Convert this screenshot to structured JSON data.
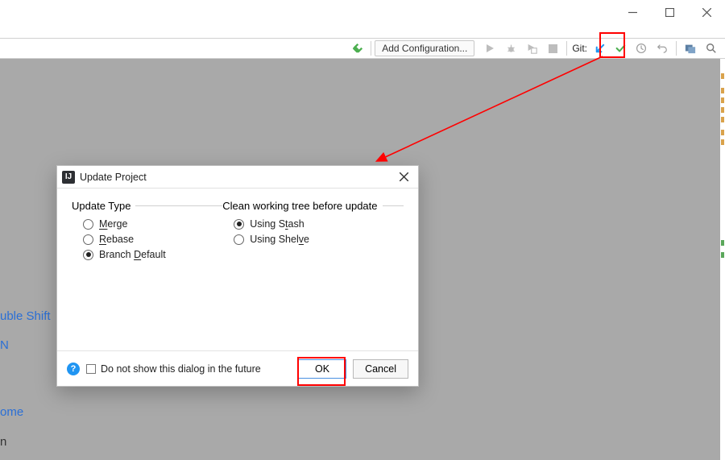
{
  "window_controls": {
    "min": "minimize-icon",
    "max": "maximize-icon",
    "close": "close-icon"
  },
  "toolbar": {
    "add_config": "Add Configuration...",
    "git_label": "Git:"
  },
  "background_links": {
    "double_shift": "uble Shift",
    "n_text": "N",
    "ome_text": "ome",
    "dash_text": "n"
  },
  "dialog": {
    "title": "Update Project",
    "group1_title": "Update Type",
    "group2_title": "Clean working tree before update",
    "options1": [
      {
        "label_pre": "",
        "mnemonic": "M",
        "label_post": "erge",
        "checked": false
      },
      {
        "label_pre": "",
        "mnemonic": "R",
        "label_post": "ebase",
        "checked": false
      },
      {
        "label_pre": "Branch ",
        "mnemonic": "D",
        "label_post": "efault",
        "checked": true
      }
    ],
    "options2": [
      {
        "label_pre": "Using S",
        "mnemonic": "t",
        "label_post": "ash",
        "checked": true
      },
      {
        "label_pre": "Using Shel",
        "mnemonic": "v",
        "label_post": "e",
        "checked": false
      }
    ],
    "footer_label": "Do not show this dialog in the future",
    "ok": "OK",
    "cancel": "Cancel"
  }
}
